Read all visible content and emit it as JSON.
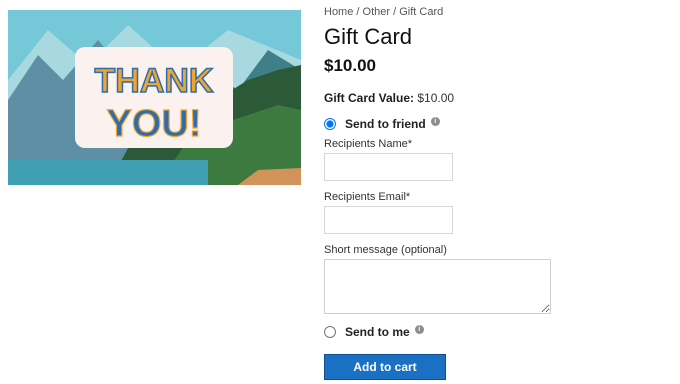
{
  "breadcrumb": {
    "home": "Home",
    "category": "Other",
    "current": "Gift Card",
    "separator": "/"
  },
  "product": {
    "title": "Gift Card",
    "price": "$10.00",
    "value_label": "Gift Card Value:",
    "value": "$10.00"
  },
  "image": {
    "line1": "THANK",
    "line2": "YOU!"
  },
  "delivery": {
    "send_to_friend": "Send to friend",
    "send_to_me": "Send to me",
    "selected": "send_to_friend"
  },
  "form": {
    "recipient_name_label": "Recipients Name*",
    "recipient_name_value": "",
    "recipient_email_label": "Recipients Email*",
    "recipient_email_value": "",
    "message_label": "Short message (optional)",
    "message_value": ""
  },
  "actions": {
    "add_to_cart": "Add to cart"
  },
  "colors": {
    "button": "#1a70c2",
    "sky": "#6fc6d8",
    "forest": "#2f5e3a",
    "letters_orange": "#f3a52b",
    "letters_blue": "#2b6db0"
  }
}
